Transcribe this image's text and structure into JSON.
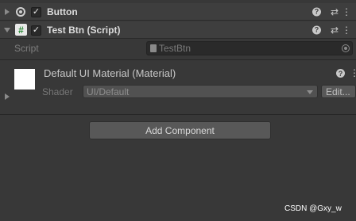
{
  "components": [
    {
      "title": "Button",
      "enabled": true,
      "icon": "button-component-icon"
    },
    {
      "title": "Test Btn (Script)",
      "enabled": true,
      "icon": "script-hash-icon",
      "icon_glyph": "#",
      "fields": {
        "script_label": "Script",
        "script_value": "TestBtn"
      }
    }
  ],
  "header_icons": {
    "help": "?",
    "presets": "⇄",
    "menu": "⋮"
  },
  "material": {
    "title": "Default UI Material (Material)",
    "shader_label": "Shader",
    "shader_value": "UI/Default",
    "edit_button": "Edit..."
  },
  "add_component_label": "Add Component",
  "watermark": "CSDN @Gxy_w",
  "colors": {
    "background": "#383838",
    "header": "#3e3e3e",
    "script_icon": "#4caf50"
  }
}
